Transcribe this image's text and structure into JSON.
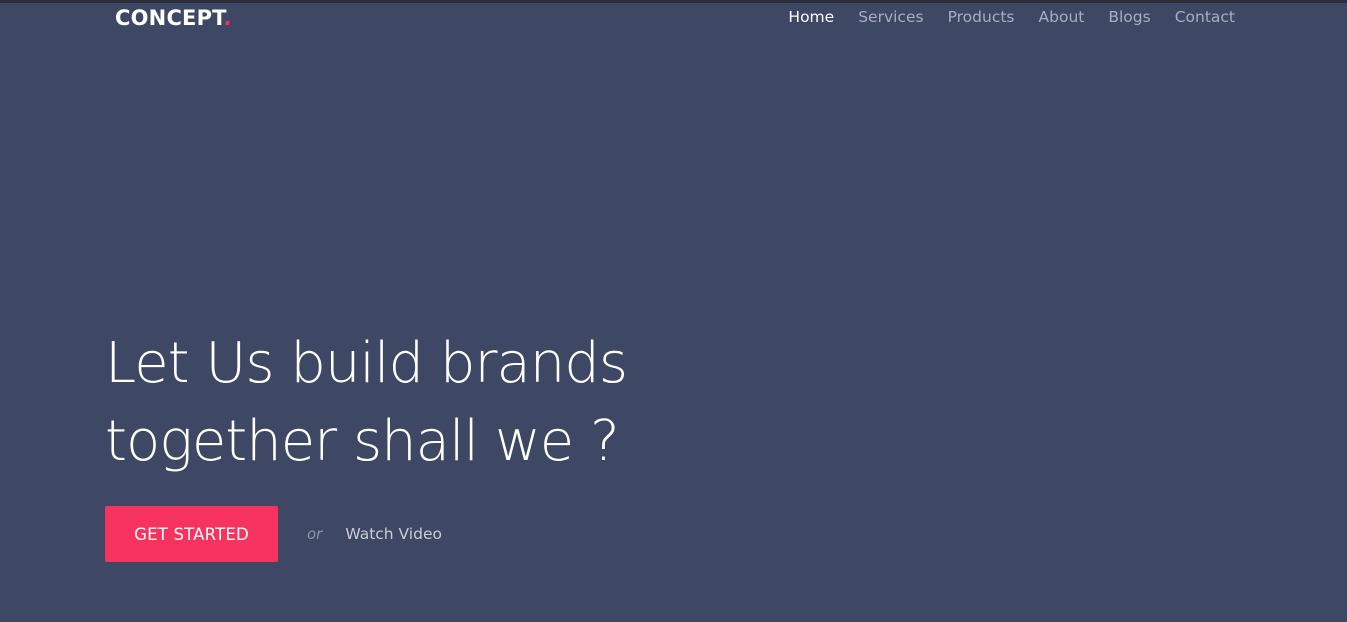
{
  "brand": {
    "name": "CONCEPT",
    "dot": ".",
    "dot_color": "#f6335e"
  },
  "nav": {
    "items": [
      {
        "label": "Home",
        "active": true
      },
      {
        "label": "Services",
        "active": false
      },
      {
        "label": "Products",
        "active": false
      },
      {
        "label": "About",
        "active": false
      },
      {
        "label": "Blogs",
        "active": false
      },
      {
        "label": "Contact",
        "active": false
      }
    ]
  },
  "hero": {
    "title_line_1": "Let Us build brands",
    "title_line_2": "together shall we ?",
    "cta_label": "GET STARTED",
    "or_text": "or",
    "watch_label": "Watch Video"
  },
  "colors": {
    "background": "#3e4764",
    "accent": "#f6335e",
    "nav_inactive": "#a8aebf",
    "nav_active": "#ffffff"
  }
}
